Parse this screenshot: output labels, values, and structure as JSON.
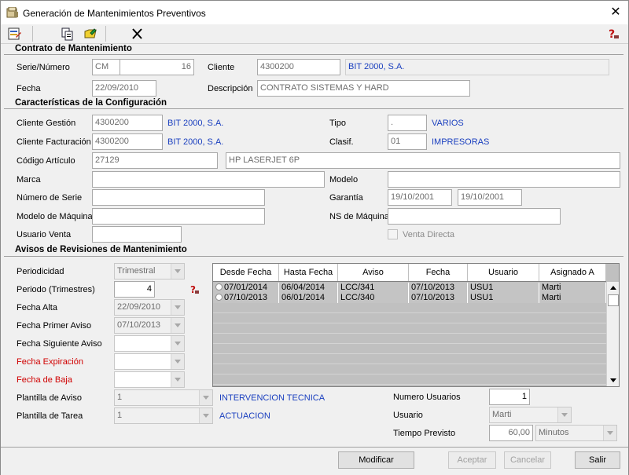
{
  "window": {
    "title": "Generación de Mantenimientos Preventivos"
  },
  "toolbar": {
    "icons": [
      "document-edit-icon",
      "copy-icon",
      "open-folder-icon",
      "delete-x-icon",
      "help-icon"
    ]
  },
  "contrato": {
    "heading": "Contrato de Mantenimiento",
    "serie_label": "Serie/Número",
    "serie": "CM",
    "numero": "16",
    "cliente_label": "Cliente",
    "cliente_code": "4300200",
    "cliente_name": "BIT 2000, S.A.",
    "fecha_label": "Fecha",
    "fecha": "22/09/2010",
    "descripcion_label": "Descripción",
    "descripcion": "CONTRATO SISTEMAS Y HARD"
  },
  "config": {
    "heading": "Características de la Configuración",
    "cliente_gestion_label": "Cliente Gestión",
    "cliente_gestion_code": "4300200",
    "cliente_gestion_name": "BIT 2000, S.A.",
    "tipo_label": "Tipo",
    "tipo_code": ".",
    "tipo_name": "VARIOS",
    "cliente_fact_label": "Cliente Facturación",
    "cliente_fact_code": "4300200",
    "cliente_fact_name": "BIT 2000, S.A.",
    "clasif_label": "Clasif.",
    "clasif_code": "01",
    "clasif_name": "IMPRESORAS",
    "codigo_label": "Código Artículo",
    "codigo": "27129",
    "articulo_desc": "HP LASERJET 6P",
    "marca_label": "Marca",
    "marca": "",
    "modelo_label": "Modelo",
    "modelo": "",
    "num_serie_label": "Número de Serie",
    "num_serie": "",
    "garantia_label": "Garantía",
    "garantia_desde": "19/10/2001",
    "garantia_hasta": "19/10/2001",
    "modelo_maquina_label": "Modelo de Máquina",
    "modelo_maquina": "",
    "ns_maquina_label": "NS de Máquina",
    "ns_maquina": "",
    "usuario_venta_label": "Usuario Venta",
    "usuario_venta": "",
    "venta_directa_label": "Venta Directa"
  },
  "avisos": {
    "heading": "Avisos de Revisiones de Mantenimiento",
    "periodicidad_label": "Periodicidad",
    "periodicidad": "Trimestral",
    "periodo_label": "Periodo (Trimestres)",
    "periodo": "4",
    "fecha_alta_label": "Fecha Alta",
    "fecha_alta": "22/09/2010",
    "fecha_primer_label": "Fecha Primer Aviso",
    "fecha_primer": "07/10/2013",
    "fecha_siguiente_label": "Fecha Siguiente Aviso",
    "fecha_siguiente": "",
    "fecha_expiracion_label": "Fecha Expiración",
    "fecha_expiracion": "",
    "fecha_baja_label": "Fecha de Baja",
    "fecha_baja": "",
    "plantilla_aviso_label": "Plantilla de Aviso",
    "plantilla_aviso": "1",
    "plantilla_aviso_name": "INTERVENCION TECNICA",
    "plantilla_tarea_label": "Plantilla de Tarea",
    "plantilla_tarea": "1",
    "plantilla_tarea_name": "ACTUACION",
    "num_usuarios_label": "Numero Usuarios",
    "num_usuarios": "1",
    "usuario_label": "Usuario",
    "usuario": "Marti",
    "tiempo_label": "Tiempo Previsto",
    "tiempo": "60,00",
    "tiempo_unit": "Minutos"
  },
  "grid": {
    "columns": [
      "Desde Fecha",
      "Hasta Fecha",
      "Aviso",
      "Fecha",
      "Usuario",
      "Asignado A"
    ],
    "rows": [
      [
        "07/01/2014",
        "06/04/2014",
        "LCC/341",
        "07/10/2013",
        "USU1",
        "Marti"
      ],
      [
        "07/10/2013",
        "06/01/2014",
        "LCC/340",
        "07/10/2013",
        "USU1",
        "Marti"
      ]
    ]
  },
  "buttons": {
    "modificar": "Modificar",
    "aceptar": "Aceptar",
    "cancelar": "Cancelar",
    "salir": "Salir"
  },
  "colors": {
    "link_blue": "#1a3fbf",
    "red_label": "#d00000",
    "grid_grey": "#c0c0c0"
  }
}
